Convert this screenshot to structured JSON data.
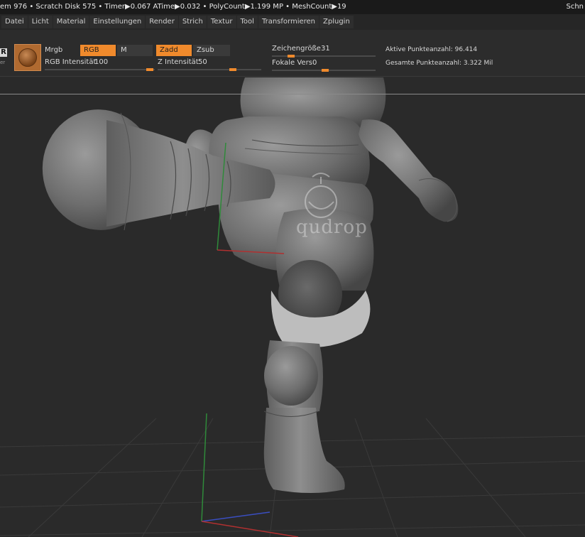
{
  "status_bar": {
    "text": "em 976 • Scratch Disk 575 •  Timer▶0.067 ATime▶0.032 • PolyCount▶1.199 MP  • MeshCount▶19",
    "right": "Schn"
  },
  "menu": [
    "Datei",
    "Licht",
    "Material",
    "Einstellungen",
    "Render",
    "Strich",
    "Textur",
    "Tool",
    "Transformieren",
    "Zplugin"
  ],
  "toolbar": {
    "mode_letter": "R",
    "mode_sub": "er",
    "mrgb_label": "Mrgb",
    "rgb_label": "RGB",
    "m_label": "M",
    "zadd_label": "Zadd",
    "zsub_label": "Zsub",
    "rgb_intensity_label": "RGB Intensität",
    "rgb_intensity_value": "100",
    "z_intensity_label": "Z Intensität",
    "z_intensity_value": "50",
    "draw_size_label": "Zeichengröße",
    "draw_size_value": "31",
    "focal_label": "Fokale Vers",
    "focal_value": "0",
    "active_points": "Aktive Punkteanzahl: 96.414",
    "total_points": "Gesamte Punkteanzahl: 3.322 Mil"
  },
  "watermark": "qudrop",
  "colors": {
    "accent": "#f08a2c",
    "background": "#2a2a2a",
    "status_bg": "#1a1a1a"
  }
}
